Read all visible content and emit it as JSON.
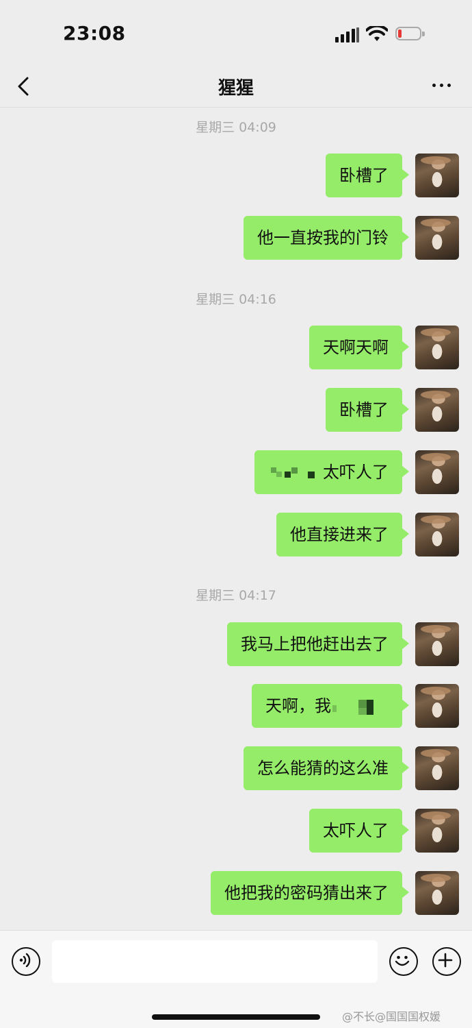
{
  "status_bar": {
    "time": "23:08",
    "battery_color": "#e53935"
  },
  "nav": {
    "title": "猩猩",
    "back_icon": "chevron-left-icon",
    "more_icon": "ellipsis-icon"
  },
  "chat": {
    "bubble_color": "#95ec69",
    "timestamps": [
      "星期三 04:09",
      "星期三 04:16",
      "星期三 04:17"
    ],
    "messages": [
      {
        "text": "卧槽了"
      },
      {
        "text": "他一直按我的门铃"
      },
      {
        "text": "天啊天啊"
      },
      {
        "text": "卧槽了"
      },
      {
        "text": "太吓人了"
      },
      {
        "text": "他直接进来了"
      },
      {
        "text": "我马上把他赶出去了"
      },
      {
        "text": "天啊，我"
      },
      {
        "text": "怎么能猜的这么准"
      },
      {
        "text": "太吓人了"
      },
      {
        "text": "他把我的密码猜出来了"
      }
    ]
  },
  "input_bar": {
    "voice_icon": "voice-icon",
    "emoji_icon": "emoji-icon",
    "plus_icon": "plus-icon",
    "input_value": ""
  },
  "watermark": "@不长@国国国权媛"
}
